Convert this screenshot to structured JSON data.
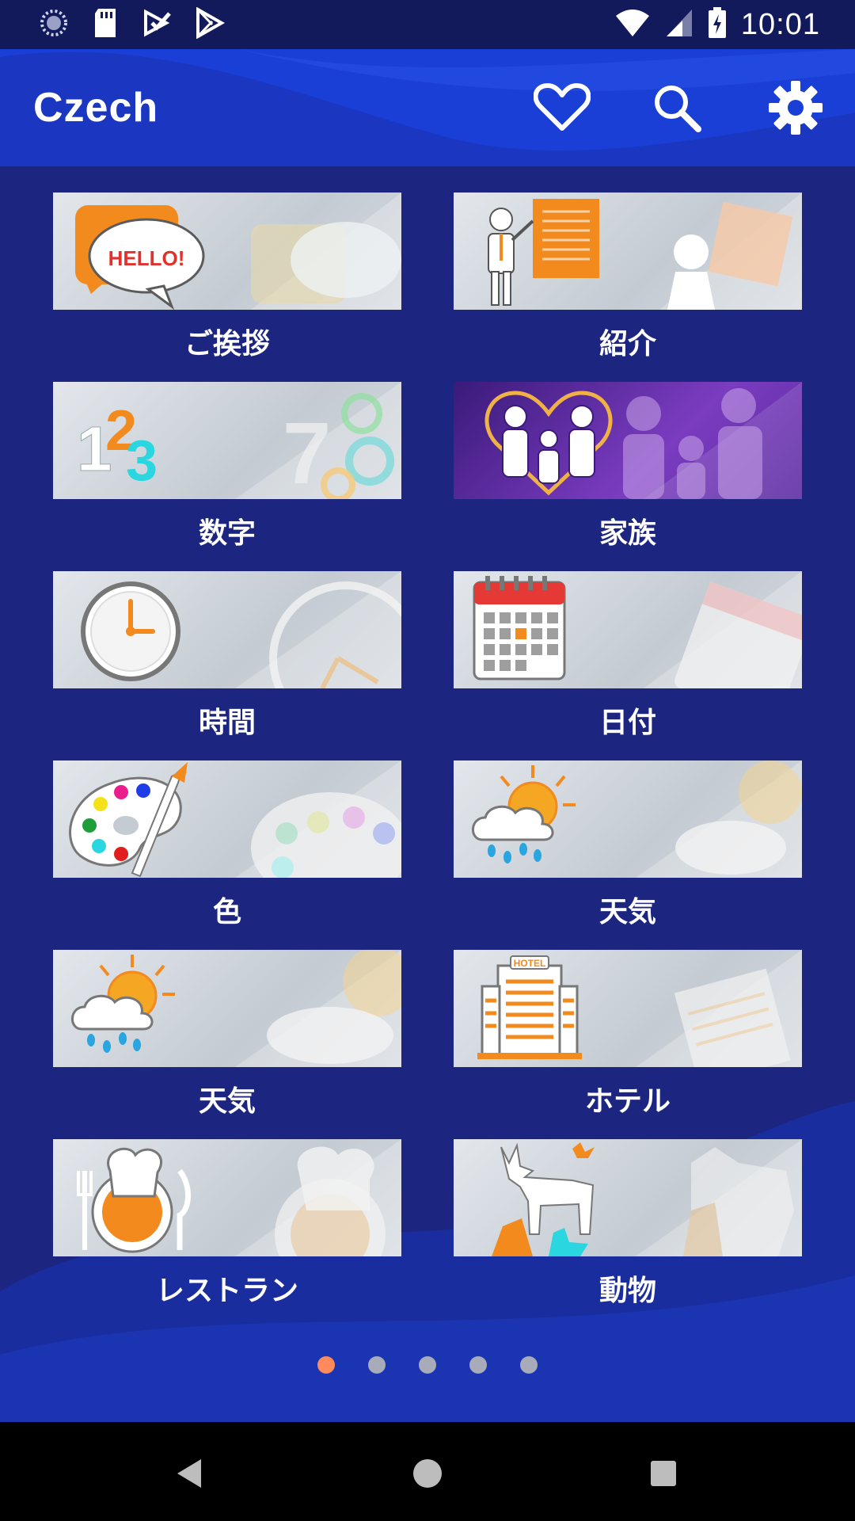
{
  "status_bar": {
    "time": "10:01",
    "left_icons": [
      "sync-icon",
      "sd-card-icon",
      "download-check-icon",
      "play-store-icon"
    ],
    "right_icons": [
      "wifi-icon",
      "signal-icon",
      "battery-charging-icon"
    ]
  },
  "app_bar": {
    "title": "Czech",
    "actions": [
      "heart-icon",
      "search-icon",
      "gear-icon"
    ]
  },
  "categories": [
    {
      "label": "ご挨拶",
      "icon": "hello-speech-bubble-icon"
    },
    {
      "label": "紹介",
      "icon": "presenter-board-icon"
    },
    {
      "label": "数字",
      "icon": "numbers-123-icon"
    },
    {
      "label": "家族",
      "icon": "family-heart-icon"
    },
    {
      "label": "時間",
      "icon": "clock-icon"
    },
    {
      "label": "日付",
      "icon": "calendar-icon"
    },
    {
      "label": "色",
      "icon": "paint-palette-icon"
    },
    {
      "label": "天気",
      "icon": "sun-cloud-rain-icon"
    },
    {
      "label": "天気",
      "icon": "sun-cloud-rain-icon"
    },
    {
      "label": "ホテル",
      "icon": "hotel-building-icon"
    },
    {
      "label": "レストラン",
      "icon": "chef-plate-icon"
    },
    {
      "label": "動物",
      "icon": "animals-icon"
    }
  ],
  "pager": {
    "total": 5,
    "active": 1
  },
  "colors": {
    "background": "#1c2680",
    "app_bar": "#1a3fd6",
    "status_bar": "#121a5c",
    "accent": "#f28a1e",
    "active_dot": "#ff8a5c"
  },
  "thumb_texts": {
    "hello": "HELLO!",
    "hotel": "HOTEL",
    "one": "1",
    "two": "2",
    "three": "3"
  }
}
